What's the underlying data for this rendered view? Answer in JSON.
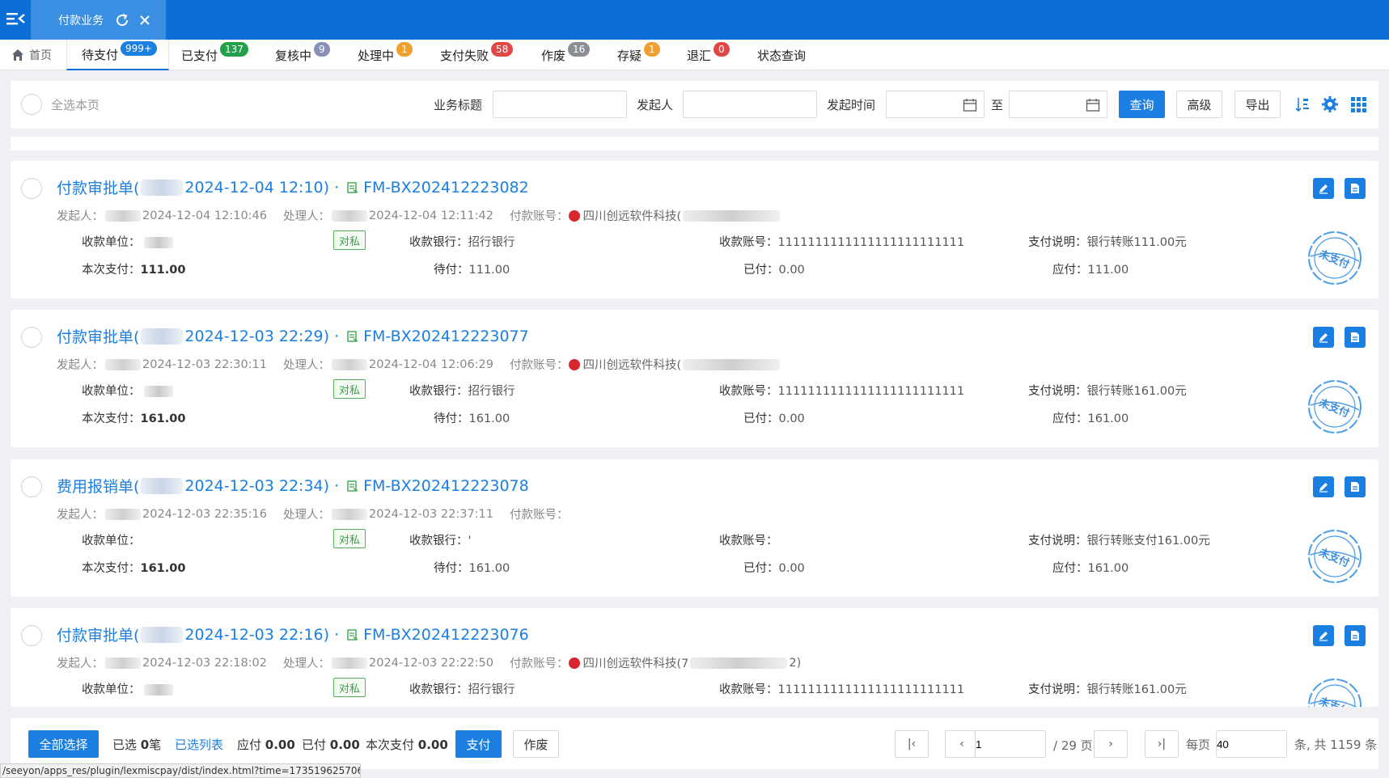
{
  "window": {
    "app_tab_title": "付款业务"
  },
  "tabs": [
    {
      "label": "首页"
    },
    {
      "label": "待支付",
      "badge": "999+",
      "color": "#1a7fe0"
    },
    {
      "label": "已支付",
      "badge": "137",
      "color": "#23a04a"
    },
    {
      "label": "复核中",
      "badge": "9",
      "color": "#8a8fb8"
    },
    {
      "label": "处理中",
      "badge": "1",
      "color": "#f0a030"
    },
    {
      "label": "支付失败",
      "badge": "58",
      "color": "#e04848"
    },
    {
      "label": "作废",
      "badge": "16",
      "color": "#8a8f96"
    },
    {
      "label": "存疑",
      "badge": "1",
      "color": "#f0a030"
    },
    {
      "label": "退汇",
      "badge": "0",
      "color": "#e04848"
    },
    {
      "label": "状态查询"
    }
  ],
  "filter": {
    "select_all_page": "全选本页",
    "title_label": "业务标题",
    "title_value": "",
    "initiator_label": "发起人",
    "initiator_value": "",
    "time_label": "发起时间",
    "to_label": "至",
    "query": "查询",
    "advanced": "高级",
    "export": "导出"
  },
  "labels": {
    "initiator": "发起人：",
    "handler": "处理人：",
    "pay_account": "付款账号：",
    "payee_unit": "收款单位：",
    "payee_bank": "收款银行：",
    "payee_account": "收款账号：",
    "pay_desc": "支付说明：",
    "this_pay": "本次支付：",
    "to_pay": "待付：",
    "paid": "已付：",
    "payable": "应付：",
    "stamp": "未支付"
  },
  "cards": [
    {
      "title_prefix": "付款审批单(",
      "title_time": "2024-12-04 12:10)",
      "sep": "·",
      "code": "FM-BX202412223082",
      "initiated_at": "2024-12-04 12:10:46",
      "handled_at": "2024-12-04 12:11:42",
      "pay_account": "四川创远软件科技(",
      "tag": "对私",
      "payee_bank": "招行银行",
      "payee_account": "1111111111111111111111111",
      "pay_desc": "银行转账111.00元",
      "this_pay": "111.00",
      "to_pay": "111.00",
      "paid": "0.00",
      "payable": "111.00"
    },
    {
      "title_prefix": "付款审批单(",
      "title_time": "2024-12-03 22:29)",
      "sep": "·",
      "code": "FM-BX202412223077",
      "initiated_at": "2024-12-03 22:30:11",
      "handled_at": "2024-12-04 12:06:29",
      "pay_account": "四川创远软件科技(",
      "tag": "对私",
      "payee_bank": "招行银行",
      "payee_account": "1111111111111111111111111",
      "pay_desc": "银行转账161.00元",
      "this_pay": "161.00",
      "to_pay": "161.00",
      "paid": "0.00",
      "payable": "161.00"
    },
    {
      "title_prefix": "费用报销单(",
      "title_time": "2024-12-03 22:34)",
      "sep": "·",
      "code": "FM-BX202412223078",
      "initiated_at": "2024-12-03 22:35:16",
      "handled_at": "2024-12-03 22:37:11",
      "pay_account": "",
      "tag": "对私",
      "payee_bank": "'",
      "payee_account": "",
      "pay_desc": "银行转账支付161.00元",
      "this_pay": "161.00",
      "to_pay": "161.00",
      "paid": "0.00",
      "payable": "161.00"
    },
    {
      "title_prefix": "付款审批单(",
      "title_time": "2024-12-03 22:16)",
      "sep": "·",
      "code": "FM-BX202412223076",
      "initiated_at": "2024-12-03 22:18:02",
      "handled_at": "2024-12-03 22:22:50",
      "pay_account": "四川创远软件科技(7",
      "pay_account_suffix": "2)",
      "tag": "对私",
      "payee_bank": "招行银行",
      "payee_account": "1111111111111111111111111",
      "pay_desc": "银行转账161.00元",
      "this_pay": "",
      "to_pay": "",
      "paid": "",
      "payable": ""
    }
  ],
  "bottom": {
    "select_all": "全部选择",
    "selected_prefix": "已选",
    "selected_count": "0",
    "selected_unit": "笔",
    "selected_list": "已选列表",
    "payable_label": "应付",
    "payable_value": "0.00",
    "paid_label": "已付",
    "paid_value": "0.00",
    "this_pay_label": "本次支付",
    "this_pay_value": "0.00",
    "pay_button": "支付",
    "void_button": "作废",
    "first": "|‹",
    "prev": "‹",
    "page_value": "1",
    "page_total": "/ 29 页",
    "next": "›",
    "last": "›|",
    "per_page_label": "每页",
    "per_page_value": "40",
    "total_text": "条, 共 1159 条"
  },
  "status_url": "/seeyon/apps_res/plugin/lexmiscpay/dist/index.html?time=1735196257064#/bus..."
}
